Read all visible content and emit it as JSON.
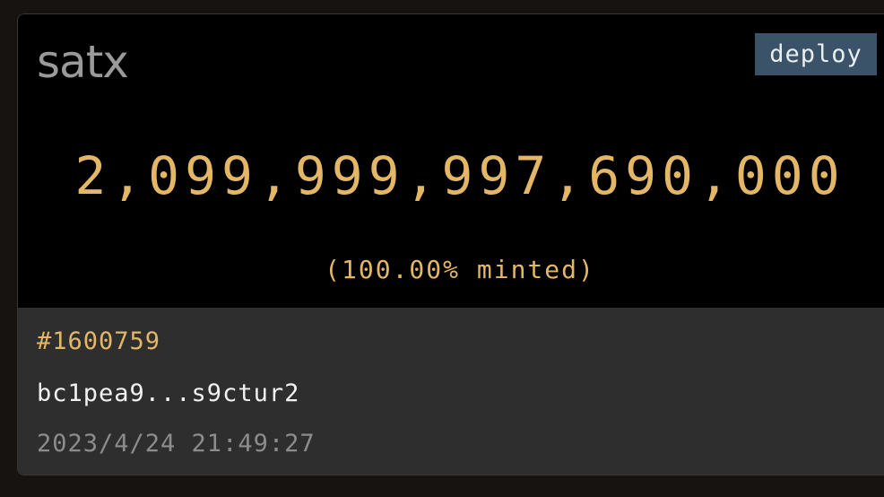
{
  "card": {
    "ticker": "satx",
    "op_badge": "deploy",
    "supply": "2,099,999,997,690,000",
    "minted": "(100.00% minted)",
    "inscription_number": "#1600759",
    "address": "bc1pea9...s9ctur2",
    "timestamp": "2023/4/24 21:49:27"
  },
  "colors": {
    "accent": "#e3b766",
    "badge_bg": "#3b5369",
    "panel_bg": "#2e2e2e",
    "top_bg": "#000000"
  }
}
